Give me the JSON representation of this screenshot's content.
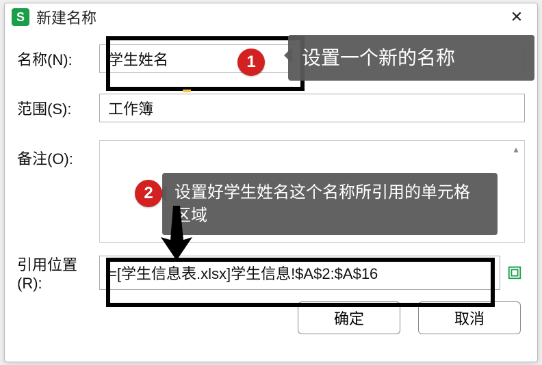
{
  "dialog": {
    "app_icon_letter": "S",
    "title": "新建名称",
    "close_glyph": "✕"
  },
  "labels": {
    "name": "名称(N):",
    "scope": "范围(S):",
    "comment": "备注(O):",
    "refers": "引用位置(R):"
  },
  "fields": {
    "name_value": "学生姓名",
    "scope_value": "工作簿",
    "comment_value": "",
    "refers_value": "=[学生信息表.xlsx]学生信息!$A$2:$A$16"
  },
  "buttons": {
    "ok": "确定",
    "cancel": "取消"
  },
  "annotations": {
    "callout1": "设置一个新的名称",
    "callout2": "设置好学生姓名这个名称所引用的单元格区域",
    "badge1": "1",
    "badge2": "2"
  }
}
